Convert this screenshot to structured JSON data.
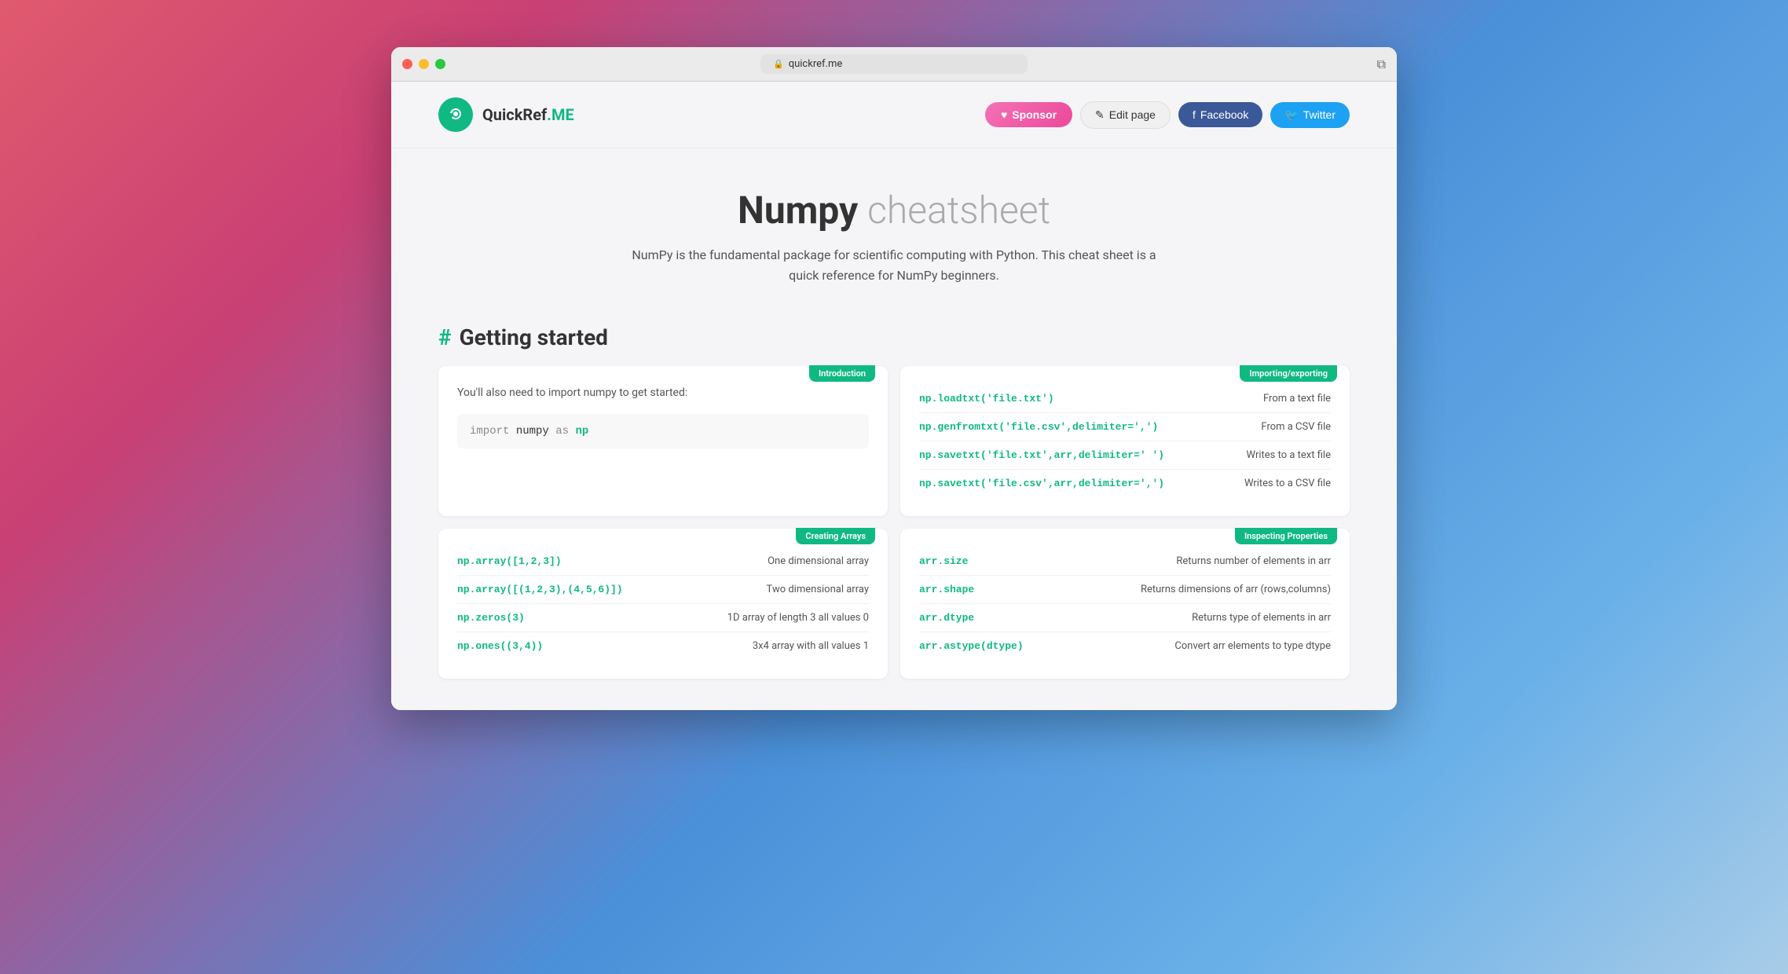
{
  "window": {
    "title": "quickref.me",
    "address": "quickref.me"
  },
  "header": {
    "logo": {
      "icon": "⟳",
      "brand": "QuickRef",
      "suffix": ".ME"
    },
    "buttons": {
      "sponsor": "Sponsor",
      "edit_page": "Edit page",
      "facebook": "Facebook",
      "twitter": "Twitter"
    }
  },
  "hero": {
    "title_bold": "Numpy",
    "title_light": "cheatsheet",
    "description": "NumPy is the fundamental package for scientific computing with Python. This cheat sheet is a quick reference for NumPy beginners."
  },
  "sections": [
    {
      "id": "getting-started",
      "heading": "Getting started",
      "cards": [
        {
          "id": "introduction",
          "badge": "Introduction",
          "intro_text": "You'll also need to import numpy to get started:",
          "code": "import numpy as np"
        },
        {
          "id": "importing-exporting",
          "badge": "Importing/exporting",
          "rows": [
            {
              "code": "np.loadtxt('file.txt')",
              "desc": "From a text file"
            },
            {
              "code": "np.genfromtxt('file.csv',delimiter=',')",
              "desc": "From a CSV file"
            },
            {
              "code": "np.savetxt('file.txt',arr,delimiter=' ')",
              "desc": "Writes to a text file"
            },
            {
              "code": "np.savetxt('file.csv',arr,delimiter=',')",
              "desc": "Writes to a CSV file"
            }
          ]
        },
        {
          "id": "creating-arrays",
          "badge": "Creating Arrays",
          "rows": [
            {
              "code": "np.array([1,2,3])",
              "desc": "One dimensional array"
            },
            {
              "code": "np.array([(1,2,3),(4,5,6)])",
              "desc": "Two dimensional array"
            },
            {
              "code": "np.zeros(3)",
              "desc": "1D array of length 3 all values 0"
            },
            {
              "code": "np.ones((3,4))",
              "desc": "3x4 array with all values 1"
            }
          ]
        },
        {
          "id": "inspecting-properties",
          "badge": "Inspecting Properties",
          "rows": [
            {
              "code": "arr.size",
              "desc": "Returns number of elements in arr"
            },
            {
              "code": "arr.shape",
              "desc": "Returns dimensions of arr (rows,columns)"
            },
            {
              "code": "arr.dtype",
              "desc": "Returns type of elements in arr"
            },
            {
              "code": "arr.astype(dtype)",
              "desc": "Convert arr elements to type dtype"
            }
          ]
        }
      ]
    }
  ]
}
